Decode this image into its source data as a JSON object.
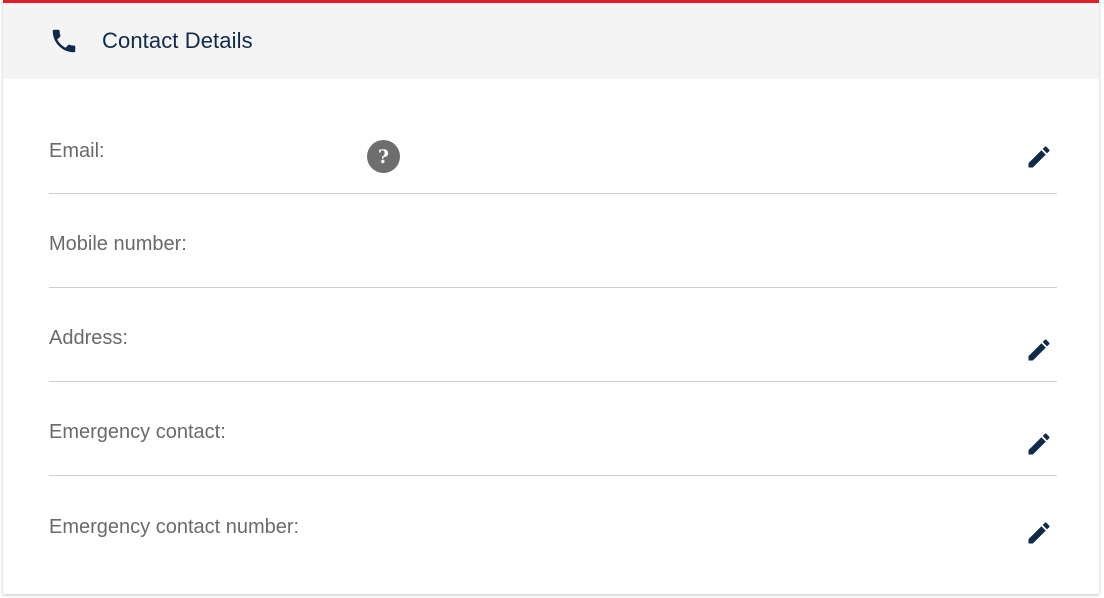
{
  "header": {
    "title": "Contact Details",
    "icon": "phone-icon",
    "accent_color": "#e21f26",
    "title_color": "#0f2a4a"
  },
  "rows": [
    {
      "label": "Email:",
      "has_help": true,
      "help_text": "?",
      "editable": true
    },
    {
      "label": "Mobile number:",
      "has_help": false,
      "editable": false
    },
    {
      "label": "Address:",
      "has_help": false,
      "editable": true
    },
    {
      "label": "Emergency contact:",
      "has_help": false,
      "editable": true
    },
    {
      "label": "Emergency contact number:",
      "has_help": false,
      "editable": true
    }
  ]
}
